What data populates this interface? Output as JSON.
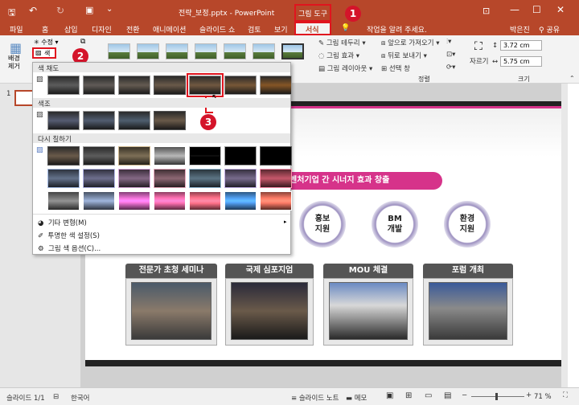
{
  "titlebar": {
    "doc_title": "전략_보정.pptx - PowerPoint",
    "context_tab": "그림 도구",
    "user": "박은진",
    "share": "공유"
  },
  "tabs": [
    "파일",
    "홈",
    "삽입",
    "디자인",
    "전환",
    "애니메이션",
    "슬라이드 쇼",
    "검토",
    "보기",
    "서식"
  ],
  "tell_me": "작업을 알려 주세요.",
  "ribbon": {
    "remove_bg": "배경\n제거",
    "corrections": "수정",
    "color": "색",
    "picture_border": "그림 테두리",
    "picture_effects": "그림 효과",
    "picture_layout": "그림 레이아웃",
    "bring_forward": "앞으로 가져오기",
    "send_backward": "뒤로 보내기",
    "selection_pane": "선택 창",
    "arrange_group": "정렬",
    "crop": "자르기",
    "height": "3.72 cm",
    "width": "5.75 cm",
    "size_group": "크기"
  },
  "dropdown": {
    "saturation": "색 채도",
    "tone": "색조",
    "recolor": "다시 칠하기",
    "more_variations": "기타 변형(M)",
    "set_transparent": "투명한 색 설정(S)",
    "color_options": "그림 색 옵션(C)..."
  },
  "slide_panel": {
    "slide_number": "1"
  },
  "slide": {
    "banner": "벤처기업 간 시너지 효과 창출",
    "circles": [
      {
        "line1": "홍보",
        "line2": "지원"
      },
      {
        "line1": "BM",
        "line2": "개발"
      },
      {
        "line1": "환경",
        "line2": "지원"
      }
    ],
    "photos": [
      {
        "title": "전문가 초청 세미나"
      },
      {
        "title": "국제 심포지엄"
      },
      {
        "title": "MOU 체결"
      },
      {
        "title": "포럼 개최"
      }
    ]
  },
  "status": {
    "slide_count": "슬라이드 1/1",
    "language": "한국어",
    "notes": "슬라이드 노트",
    "comments": "메모",
    "zoom": "71 %"
  },
  "steps": [
    "1",
    "2",
    "3"
  ],
  "colors": {
    "accent": "#b7472a",
    "highlight": "#e0141e",
    "banner": "#d6338a"
  }
}
